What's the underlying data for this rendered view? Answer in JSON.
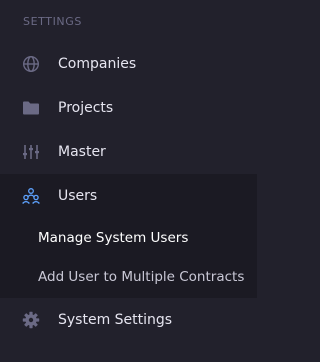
{
  "sidebar": {
    "section_header": "SETTINGS",
    "items": [
      {
        "label": "Companies",
        "icon": "globe-icon"
      },
      {
        "label": "Projects",
        "icon": "folder-icon"
      },
      {
        "label": "Master",
        "icon": "sliders-icon"
      },
      {
        "label": "Users",
        "icon": "users-icon"
      },
      {
        "label": "System Settings",
        "icon": "gear-icon"
      }
    ],
    "users_submenu": [
      {
        "label": "Manage System Users",
        "active": true
      },
      {
        "label": "Add User to Multiple Contracts",
        "active": false
      }
    ]
  },
  "colors": {
    "background": "#22212c",
    "submenu_background": "#1b1a23",
    "text": "#e6e5f0",
    "muted_text": "#6b6a85",
    "icon_muted": "#6b6a85",
    "accent": "#5ea3ff"
  }
}
